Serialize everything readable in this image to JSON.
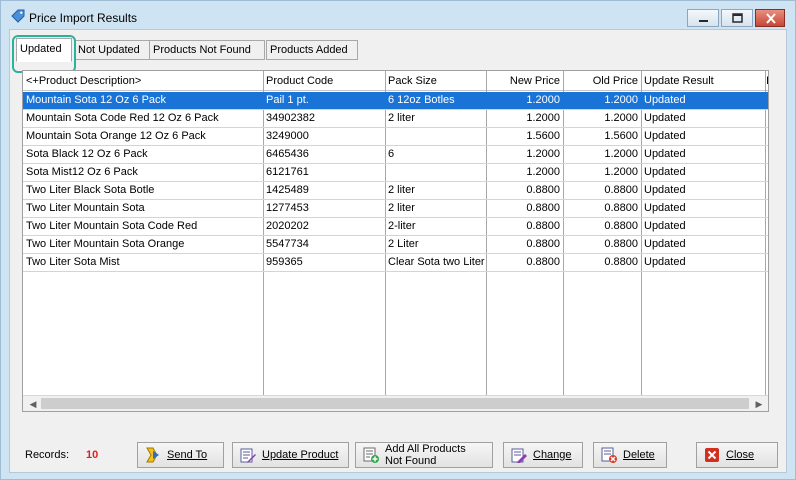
{
  "window": {
    "title": "Price Import Results"
  },
  "tabs": [
    {
      "label": "Updated",
      "active": true
    },
    {
      "label": "Not Updated",
      "active": false
    },
    {
      "label": "Products Not Found",
      "active": false
    },
    {
      "label": "Products Added",
      "active": false
    }
  ],
  "table": {
    "columns": [
      "<+Product Description>",
      "Product Code",
      "Pack Size",
      "New Price",
      "Old Price",
      "Update Result",
      "I"
    ],
    "rows": [
      {
        "description": "Mountain Sota 12 Oz 6 Pack",
        "code": "Pail 1 pt.",
        "pack": "6 12oz Botles",
        "new_price": "1.2000",
        "old_price": "1.2000",
        "result": "Updated",
        "selected": true
      },
      {
        "description": "Mountain Sota Code Red 12 Oz 6 Pack",
        "code": "34902382",
        "pack": "2 liter",
        "new_price": "1.2000",
        "old_price": "1.2000",
        "result": "Updated",
        "selected": false
      },
      {
        "description": "Mountain Sota Orange 12 Oz 6 Pack",
        "code": "3249000",
        "pack": "",
        "new_price": "1.5600",
        "old_price": "1.5600",
        "result": "Updated",
        "selected": false
      },
      {
        "description": "Sota Black 12 Oz 6 Pack",
        "code": "6465436",
        "pack": "6",
        "new_price": "1.2000",
        "old_price": "1.2000",
        "result": "Updated",
        "selected": false
      },
      {
        "description": "Sota Mist12 Oz 6 Pack",
        "code": "6121761",
        "pack": "",
        "new_price": "1.2000",
        "old_price": "1.2000",
        "result": "Updated",
        "selected": false
      },
      {
        "description": "Two Liter Black Sota Botle",
        "code": "1425489",
        "pack": "2 liter",
        "new_price": "0.8800",
        "old_price": "0.8800",
        "result": "Updated",
        "selected": false
      },
      {
        "description": "Two Liter Mountain Sota",
        "code": "1277453",
        "pack": "2 liter",
        "new_price": "0.8800",
        "old_price": "0.8800",
        "result": "Updated",
        "selected": false
      },
      {
        "description": "Two Liter Mountain Sota Code Red",
        "code": "2020202",
        "pack": "2-liter",
        "new_price": "0.8800",
        "old_price": "0.8800",
        "result": "Updated",
        "selected": false
      },
      {
        "description": "Two Liter Mountain Sota Orange",
        "code": "5547734",
        "pack": "2 Liter",
        "new_price": "0.8800",
        "old_price": "0.8800",
        "result": "Updated",
        "selected": false
      },
      {
        "description": "Two Liter Sota Mist",
        "code": "959365",
        "pack": "Clear Sota two Liter",
        "new_price": "0.8800",
        "old_price": "0.8800",
        "result": "Updated",
        "selected": false
      }
    ]
  },
  "footer": {
    "records_label": "Records:",
    "records_value": "10",
    "buttons": [
      {
        "label": "Send To",
        "icon": "send-to-icon"
      },
      {
        "label": "Update Product",
        "icon": "update-product-icon"
      },
      {
        "label": "Add All Products Not Found",
        "icon": "add-products-icon"
      },
      {
        "label": "Change",
        "icon": "change-icon"
      },
      {
        "label": "Delete",
        "icon": "delete-icon"
      },
      {
        "label": "Close",
        "icon": "close-icon"
      }
    ]
  },
  "colors": {
    "selection": "#1a73d7",
    "tab_highlight": "#28b49a",
    "records_value": "#e02020",
    "close_button": "#c64836"
  }
}
